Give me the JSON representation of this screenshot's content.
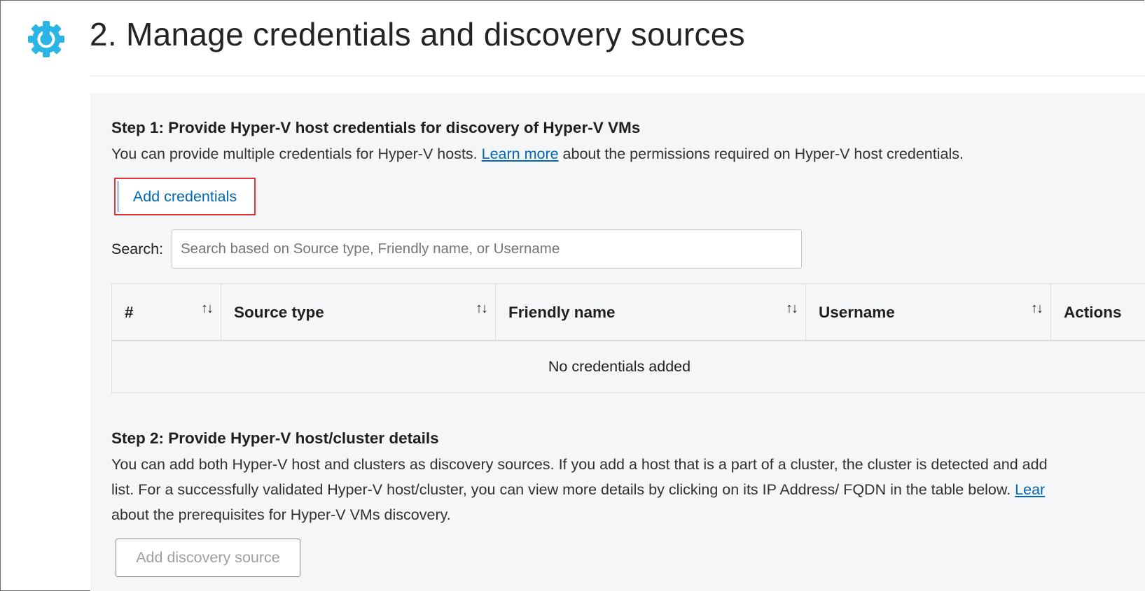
{
  "header": {
    "title": "2. Manage credentials and discovery sources",
    "icon": "gear-icon",
    "icon_color": "#2bb5e4"
  },
  "step1": {
    "heading": "Step 1: Provide Hyper-V host credentials for discovery of Hyper-V VMs",
    "desc_before": "You can provide multiple credentials for Hyper-V hosts. ",
    "link": "Learn more",
    "desc_after": " about the permissions required on Hyper-V host credentials.",
    "add_button": "Add credentials"
  },
  "search": {
    "label": "Search:",
    "placeholder": "Search based on Source type, Friendly name, or Username"
  },
  "table": {
    "columns": [
      {
        "label": "#",
        "sortable": true
      },
      {
        "label": "Source type",
        "sortable": true
      },
      {
        "label": "Friendly name",
        "sortable": true
      },
      {
        "label": "Username",
        "sortable": true
      },
      {
        "label": "Actions",
        "sortable": false
      }
    ],
    "sort_icon": "↑↓",
    "empty_message": "No credentials added"
  },
  "step2": {
    "heading": "Step 2: Provide Hyper-V host/cluster details",
    "line1": "You can add both Hyper-V host and clusters as discovery sources. If you add a host that is a part of a cluster, the cluster is detected and add",
    "line2_before": "list. For a successfully validated Hyper-V host/cluster, you can view more details by clicking on its IP Address/ FQDN in the table below. ",
    "line2_link": "Lear",
    "line3": "about the prerequisites for Hyper-V VMs discovery.",
    "add_button": "Add discovery source"
  },
  "colors": {
    "accent": "#0067b8",
    "highlight_border": "#e6323b",
    "panel_bg": "#f5f6f7"
  }
}
